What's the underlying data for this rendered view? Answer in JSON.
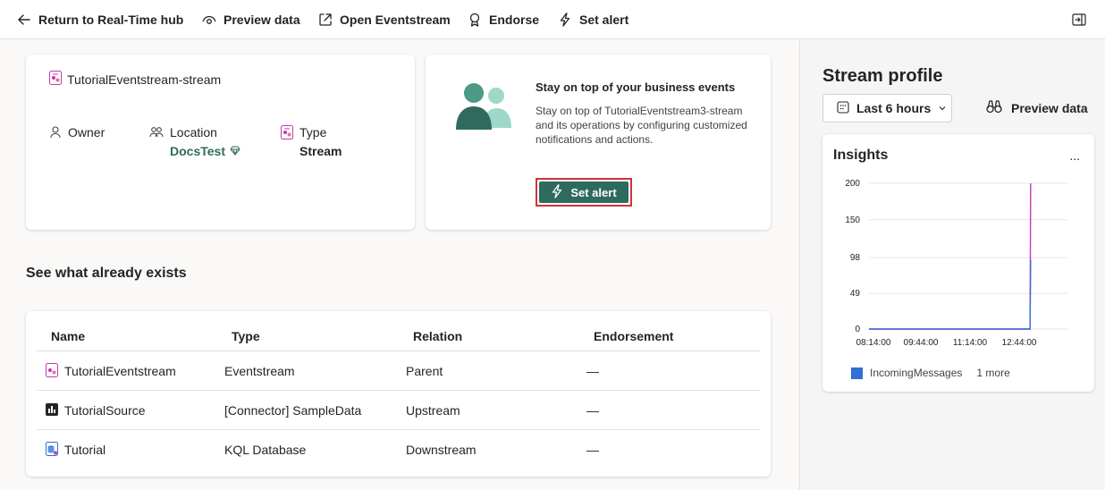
{
  "toolbar": {
    "back_label": "Return to Real-Time hub",
    "preview_label": "Preview data",
    "open_label": "Open Eventstream",
    "endorse_label": "Endorse",
    "alert_label": "Set alert"
  },
  "details": {
    "stream_name": "TutorialEventstream-stream",
    "owner_label": "Owner",
    "location_label": "Location",
    "location_value": "DocsTest",
    "type_label": "Type",
    "type_value": "Stream"
  },
  "promo": {
    "title": "Stay on top of your business events",
    "text": "Stay on top of TutorialEventstream3-stream and its operations by configuring customized notifications and actions.",
    "button_label": "Set alert"
  },
  "existing": {
    "title": "See what already exists",
    "headers": [
      "Name",
      "Type",
      "Relation",
      "Endorsement"
    ],
    "rows": [
      {
        "name": "TutorialEventstream",
        "type": "Eventstream",
        "relation": "Parent",
        "endorsement": "—",
        "icon": "eventstream-icon"
      },
      {
        "name": "TutorialSource",
        "type": "[Connector] SampleData",
        "relation": "Upstream",
        "endorsement": "—",
        "icon": "connector-icon"
      },
      {
        "name": "Tutorial",
        "type": "KQL Database",
        "relation": "Downstream",
        "endorsement": "—",
        "icon": "kql-database-icon"
      }
    ]
  },
  "profile": {
    "title": "Stream profile",
    "time_range": "Last 6 hours",
    "preview_label": "Preview data",
    "insights_title": "Insights",
    "more_label": "...",
    "legend_series": "IncomingMessages",
    "legend_more": "1 more"
  },
  "colors": {
    "accent": "#2e6b5e",
    "highlight_border": "#d13438",
    "series_blue": "#2f6fd6",
    "series_pink": "#c239b3"
  },
  "chart_data": {
    "type": "line",
    "x_ticks": [
      "08:14:00",
      "09:44:00",
      "11:14:00",
      "12:44:00"
    ],
    "y_ticks": [
      "0",
      "49",
      "98",
      "150",
      "200"
    ],
    "ylim": [
      0,
      200
    ],
    "x_points": [
      "08:14:00",
      "09:44:00",
      "11:14:00",
      "12:44:00",
      "13:20:00",
      "13:21:00"
    ],
    "series": [
      {
        "name": "IncomingMessages",
        "color": "#2f6fd6",
        "values": [
          0,
          0,
          0,
          0,
          0,
          95
        ]
      },
      {
        "color": "#c239b3",
        "values": [
          0,
          0,
          0,
          0,
          0,
          200
        ]
      }
    ]
  }
}
